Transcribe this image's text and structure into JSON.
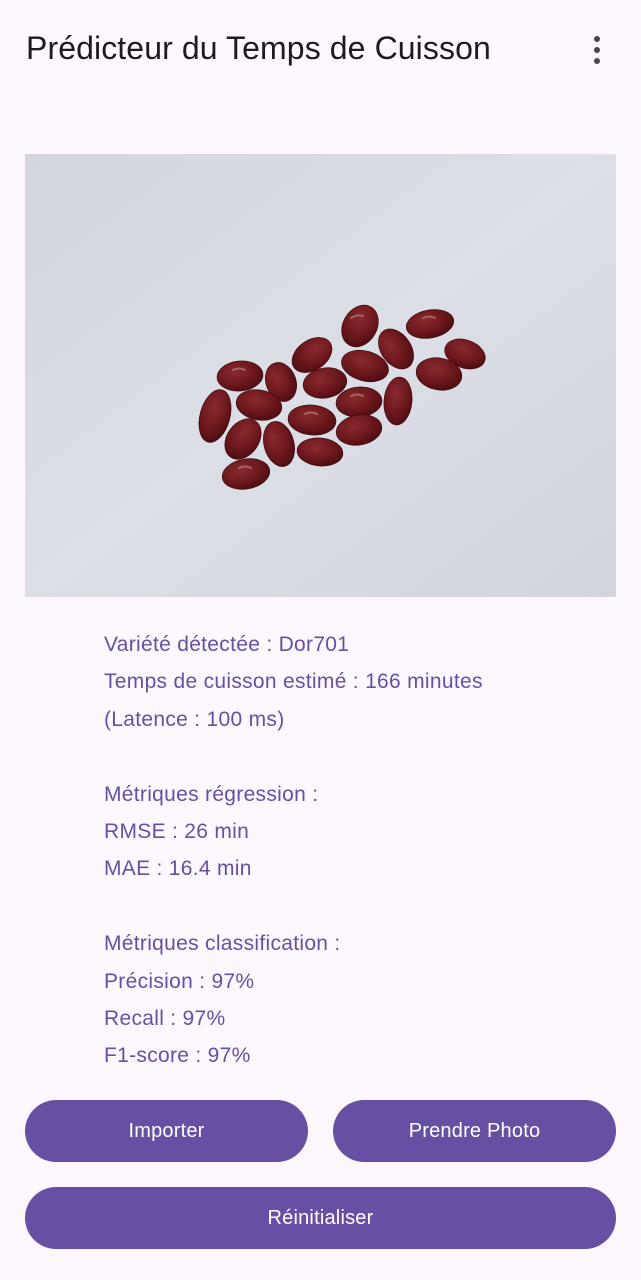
{
  "app_bar": {
    "title": "Prédicteur du Temps de Cuisson",
    "overflow_icon": "more-vert-icon"
  },
  "image": {
    "subject": "red kidney beans on white paper"
  },
  "results": {
    "variety": "Variété détectée : Dor701",
    "cook_time": "Temps de cuisson estimé : 166 minutes",
    "latency": "(Latence : 100 ms)",
    "regression_header": "Métriques régression :",
    "rmse": "RMSE : 26 min",
    "mae": "MAE : 16.4 min",
    "classification_header": "Métriques classification :",
    "precision": "Précision : 97%",
    "recall": "Recall : 97%",
    "f1": "F1-score : 97%"
  },
  "buttons": {
    "import_label": "Importer",
    "photo_label": "Prendre Photo",
    "reset_label": "Réinitialiser"
  },
  "colors": {
    "background": "#fef7fe",
    "primary": "#6750a4",
    "title_text": "#1d1b20",
    "bean": "#6e1a1e"
  }
}
